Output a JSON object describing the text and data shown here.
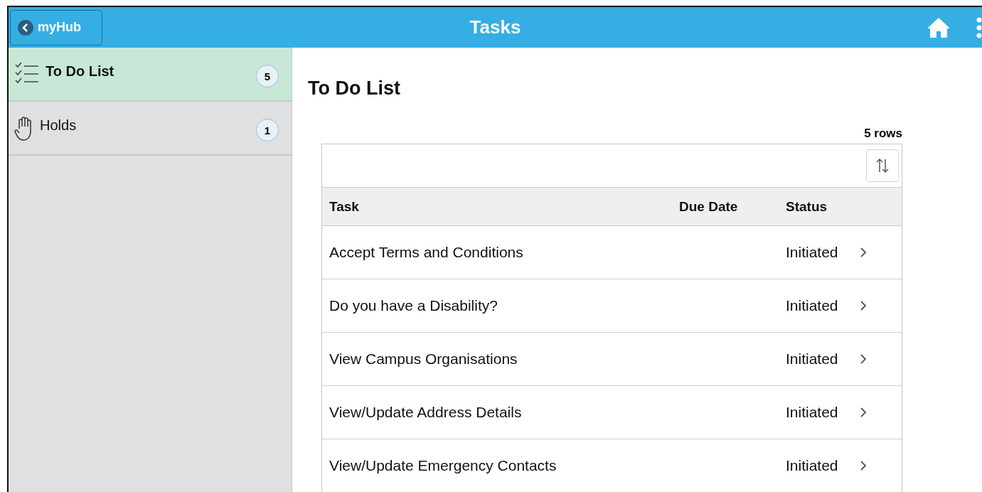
{
  "header": {
    "back_button": "myHub",
    "title": "Tasks"
  },
  "sidebar": {
    "items": [
      {
        "kind": "checklist",
        "label": "To Do List",
        "count": "5",
        "selected": true
      },
      {
        "kind": "hand",
        "label": "Holds",
        "count": "1",
        "selected": false
      }
    ]
  },
  "content": {
    "title": "To Do List",
    "row_count": "5 rows",
    "table": {
      "columns": [
        "Task",
        "Due Date",
        "Status"
      ],
      "rows": [
        {
          "task": "Accept Terms and Conditions",
          "status": "Initiated"
        },
        {
          "task": "Do you have a Disability?",
          "status": "Initiated"
        },
        {
          "task": "View Campus Organisations",
          "status": "Initiated"
        },
        {
          "task": "View/Update Address Details",
          "status": "Initiated"
        },
        {
          "task": "View/Update Emergency Contacts",
          "status": "Initiated"
        }
      ]
    }
  }
}
